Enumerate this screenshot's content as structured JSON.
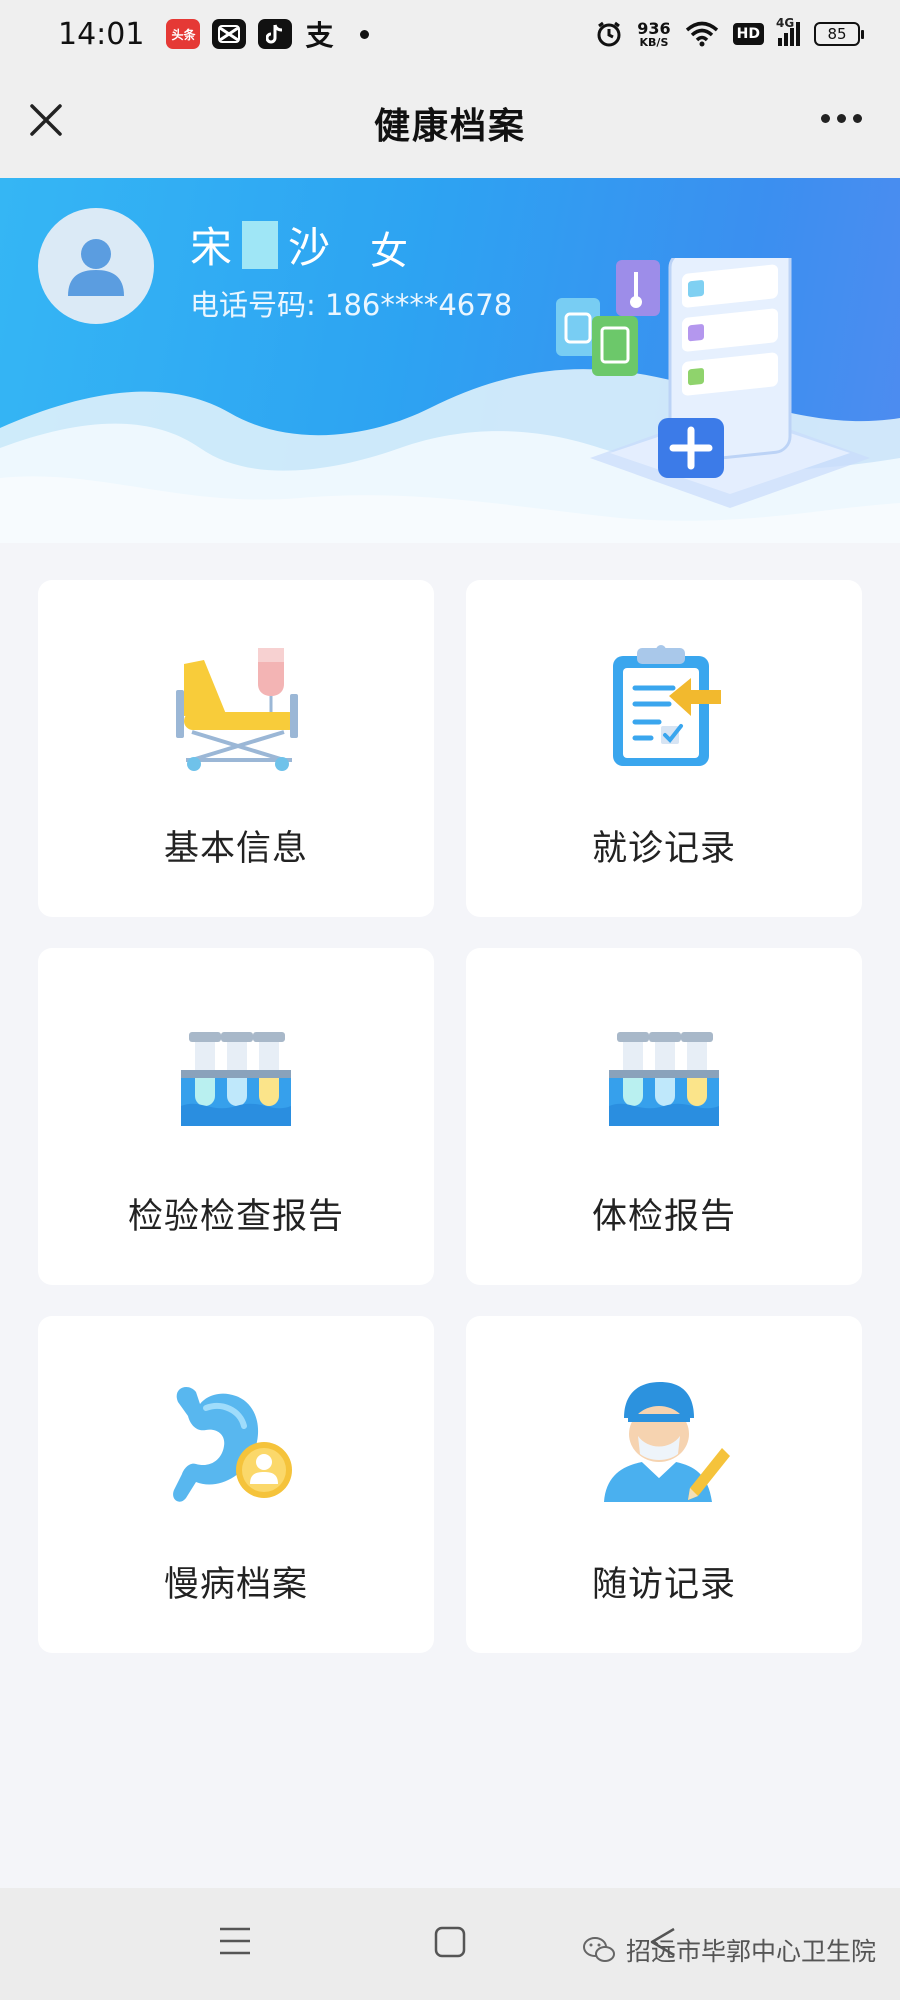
{
  "status_bar": {
    "time": "14:01",
    "app_icons": [
      "toutiao-icon",
      "capcut-icon",
      "douyin-icon",
      "alipay-icon"
    ],
    "toutiao_label": "头条",
    "alipay_label": "支",
    "net_speed_value": "936",
    "net_speed_unit": "KB/S",
    "hd_label": "HD",
    "signal_label": "4G",
    "battery": "85"
  },
  "nav": {
    "title": "健康档案"
  },
  "profile": {
    "name_first": "宋",
    "name_last": "沙",
    "gender": "女",
    "phone": "电话号码: 186****4678"
  },
  "cards": [
    {
      "label": "基本信息",
      "icon": "hospital-bed-icon"
    },
    {
      "label": "就诊记录",
      "icon": "clipboard-icon"
    },
    {
      "label": "检验检查报告",
      "icon": "test-tubes-icon"
    },
    {
      "label": "体检报告",
      "icon": "test-tubes-icon"
    },
    {
      "label": "慢病档案",
      "icon": "stomach-icon"
    },
    {
      "label": "随访记录",
      "icon": "doctor-icon"
    }
  ],
  "footer": {
    "watermark": "招远市毕郭中心卫生院"
  },
  "colors": {
    "banner_start": "#35b6f4",
    "banner_end": "#4f8cf0",
    "page_bg": "#f4f5f9",
    "card_bg": "#ffffff"
  }
}
